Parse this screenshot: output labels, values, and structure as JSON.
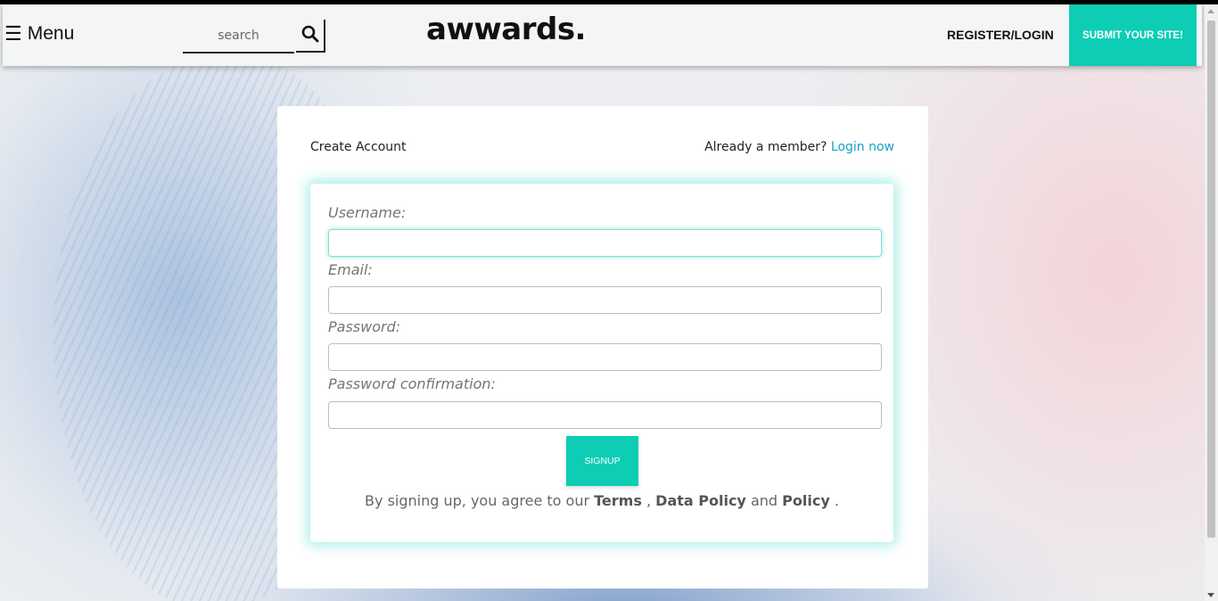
{
  "navbar": {
    "menu_icon": "hamburger-icon",
    "menu_label": "Menu",
    "search_placeholder": "search",
    "search_icon": "search-icon",
    "logo": "awwards.",
    "register_login": "REGISTER/LOGIN",
    "submit_site": "SUBMIT YOUR SITE!"
  },
  "card": {
    "title": "Create Account",
    "already_member": "Already a member?",
    "login_now": "Login now"
  },
  "form": {
    "fields": [
      {
        "label": "Username:",
        "value": ""
      },
      {
        "label": "Email:",
        "value": ""
      },
      {
        "label": "Password:",
        "value": ""
      },
      {
        "label": "Password confirmation:",
        "value": ""
      }
    ],
    "signup_label": "SIGNUP",
    "terms_prefix": "By signing up, you agree to our",
    "terms_link": "Terms",
    "terms_sep": ",",
    "data_policy_link": "Data Policy",
    "terms_and": "and",
    "policy_link": "Policy",
    "terms_end": "."
  },
  "colors": {
    "accent": "#0dcdb5",
    "link": "#1ba1c5"
  }
}
